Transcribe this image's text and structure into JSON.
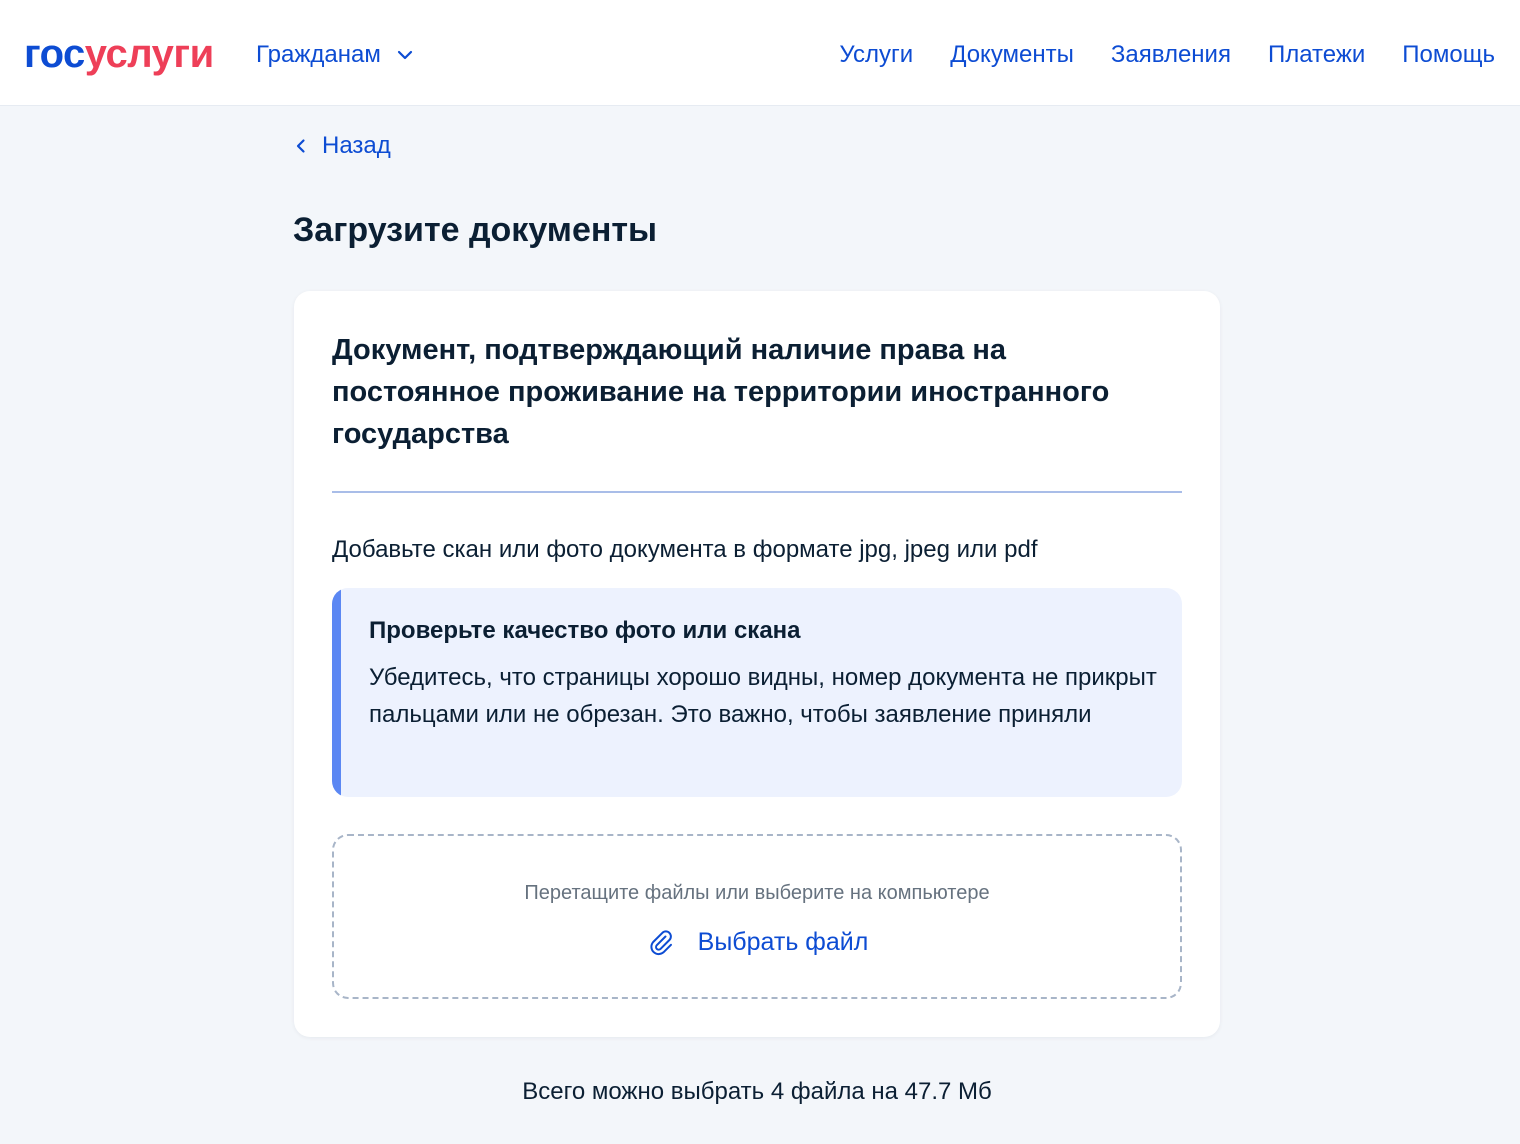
{
  "header": {
    "logo": {
      "part1": "гос",
      "part2": "услуги"
    },
    "audience": {
      "label": "Гражданам",
      "icon": "chevron-down-icon"
    },
    "nav": [
      {
        "label": "Услуги"
      },
      {
        "label": "Документы"
      },
      {
        "label": "Заявления"
      },
      {
        "label": "Платежи"
      },
      {
        "label": "Помощь"
      }
    ]
  },
  "back": {
    "label": "Назад",
    "icon": "chevron-left-icon"
  },
  "page_title": "Загрузите документы",
  "card": {
    "title": "Документ, подтверждающий наличие права на постоянное проживание на территории иностранного государства",
    "hint": "Добавьте скан или фото документа в формате jpg, jpeg или pdf",
    "notice": {
      "title": "Проверьте качество фото или скана",
      "text": "Убедитесь, что страницы хорошо видны, номер документа не прикрыт пальцами или не обрезан. Это важно, чтобы заявление приняли"
    },
    "upload": {
      "drop_text": "Перетащите файлы или выберите на компьютере",
      "button_label": "Выбрать файл",
      "icon": "paperclip-icon"
    }
  },
  "limit_text": "Всего можно выбрать 4 файла на 47.7 Мб",
  "colors": {
    "brand_blue": "#0d4cd3",
    "brand_red": "#ee3f58",
    "notice_bg": "#edf2fe",
    "notice_accent": "#5b87f3",
    "page_bg": "#f3f6fa"
  }
}
